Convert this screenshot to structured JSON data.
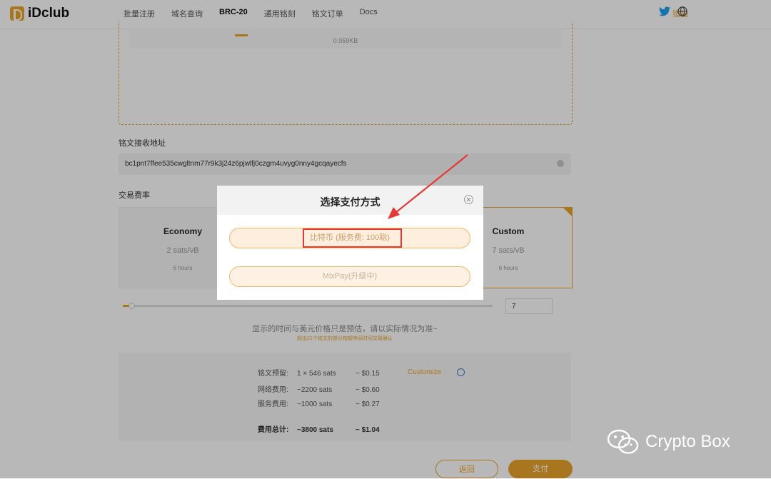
{
  "brand": {
    "name": "iDclub",
    "accent": "#e9a42b"
  },
  "nav": {
    "items": [
      "批量注册",
      "域名查询",
      "BRC-20",
      "通用铭刻",
      "铭文订单",
      "Docs"
    ],
    "active": "BRC-20",
    "login": "猎猫"
  },
  "upload": {
    "file_size": "0.059KB"
  },
  "address": {
    "label": "铭文接收地址",
    "value": "bc1pnt7ffee535cwgltnm77r9k3j24z6pjwlfj0czgm4uvyg0nny4gcqayecfs"
  },
  "fee": {
    "label": "交易费率",
    "options": [
      {
        "name": "Economy",
        "rate": "2 sats/vB",
        "time": "6 hours"
      },
      {
        "name": "Custom",
        "rate": "7 sats/vB",
        "time": "6 hours"
      }
    ],
    "slider_value": 0.03,
    "custom_value": "7"
  },
  "notes": {
    "line1": "显示的时间与美元价格只是预估，请以实际情况为准~",
    "line2": "超出21个铭文的部分按顺序同时间交易确认"
  },
  "summary": {
    "rows": [
      {
        "key": "铭文预留:",
        "sats": "1 × 546  sats",
        "usd": "~ $0.15"
      },
      {
        "key": "网络费用:",
        "sats": "~2200  sats",
        "usd": "~ $0.60"
      },
      {
        "key": "服务费用:",
        "sats": "~1000  sats",
        "usd": "~ $0.27"
      }
    ],
    "total": {
      "key": "费用总计:",
      "sats": "~3800  sats",
      "usd": "~ $1.04"
    },
    "customize": "Customize"
  },
  "buttons": {
    "back": "返回",
    "pay": "支付"
  },
  "modal": {
    "title": "选择支付方式",
    "options": [
      {
        "label": "比特币 (服务费: 100聪)"
      },
      {
        "label": "MixPay(升级中)"
      }
    ]
  },
  "watermark": {
    "text": "Crypto Box"
  }
}
